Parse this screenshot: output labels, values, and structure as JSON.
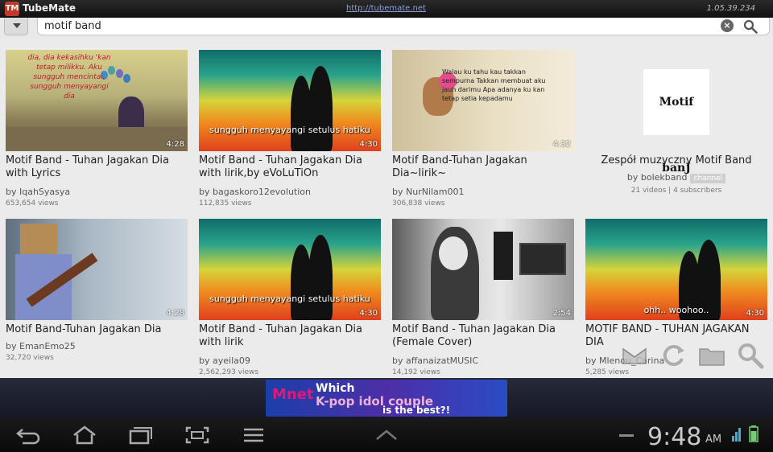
{
  "app": {
    "name": "TubeMate",
    "url": "http://tubemate.net",
    "version": "1.05.39.234"
  },
  "search": {
    "query": "motif band",
    "placeholder": ""
  },
  "videos": [
    {
      "title": "Motif Band - Tuhan Jagakan Dia with Lyrics",
      "author": "by IqahSyasya",
      "views": "653,654 views",
      "duration": "4:28",
      "caption": "dia, dia kekasihku 'kan tetap milikku. Aku sungguh mencintai, sungguh menyayangi dia"
    },
    {
      "title": "Motif Band - Tuhan Jagakan Dia with lirik,by eVoLuTiOn",
      "author": "by bagaskoro12evolution",
      "views": "112,835 views",
      "duration": "4:30",
      "caption": "sungguh menyayangi setulus hatiku"
    },
    {
      "title": "Motif Band-Tuhan Jagakan Dia~lirik~",
      "author": "by NurNilam001",
      "views": "306,838 views",
      "duration": "4:32",
      "caption": "Walau ku tahu kau takkan sempurna Takkan membuat aku jauh darimu Apa adanya ku kan tetap setia kepadamu"
    },
    {
      "title": "Motif Band-Tuhan Jagakan Dia",
      "author": "by EmanEmo25",
      "views": "32,720 views",
      "duration": "4:28"
    },
    {
      "title": "Motif Band - Tuhan Jagakan Dia with lirik",
      "author": "by ayeila09",
      "views": "2,562,293 views",
      "duration": "4:30",
      "caption": "sungguh menyayangi setulus hatiku"
    },
    {
      "title": "Motif Band - Tuhan Jagakan Dia (Female Cover)",
      "author": "by affanaizatMUSIC",
      "views": "14,192 views",
      "duration": "2:54"
    },
    {
      "title": "MOTIF BAND - TUHAN JAGAKAN DIA",
      "author": "by Mlenou_Carina",
      "views": "5,285 views",
      "duration": "4:30",
      "caption": "ohh.. woohoo.."
    }
  ],
  "channel": {
    "logo_text": "Motif banJ",
    "title": "Zespół muzyczny Motif Band",
    "author": "by bolekband",
    "badge": "channel",
    "stats": "21 videos | 4 subscribers"
  },
  "ad": {
    "brand": "Mnet",
    "line1": "Which",
    "line2": "K-pop idol couple",
    "line3": "is the best?!"
  },
  "status": {
    "time": "9:48",
    "ampm": "AM"
  },
  "colors": {
    "accent": "#c0392b",
    "grid_background": "#ebebeb",
    "ad_pink": "#e0187a"
  }
}
